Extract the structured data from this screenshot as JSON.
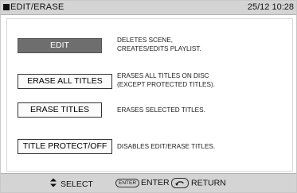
{
  "header": {
    "title": "EDIT/ERASE",
    "clock": "25/12 10:28"
  },
  "options": [
    {
      "label": "EDIT",
      "description": [
        "DELETES SCENE,",
        "CREATES/EDITS PLAYLIST."
      ],
      "selected": true
    },
    {
      "label": "ERASE ALL TITLES",
      "description": [
        "ERASES ALL TITLES ON DISC",
        "(EXCEPT PROTECTED TITLES)."
      ],
      "selected": false
    },
    {
      "label": "ERASE TITLES",
      "description": [
        "ERASES SELECTED TITLES."
      ],
      "selected": false
    },
    {
      "label": "TITLE PROTECT/OFF",
      "description": [
        "DISABLES EDIT/ERASE TITLES."
      ],
      "selected": false
    }
  ],
  "footer": {
    "select_label": "SELECT",
    "enter_badge": "ENTER",
    "enter_label": "ENTER",
    "return_label": "RETURN"
  },
  "colors": {
    "selected_button_bg": "#6e6e6e",
    "bar_bg": "#d4d4d4"
  }
}
